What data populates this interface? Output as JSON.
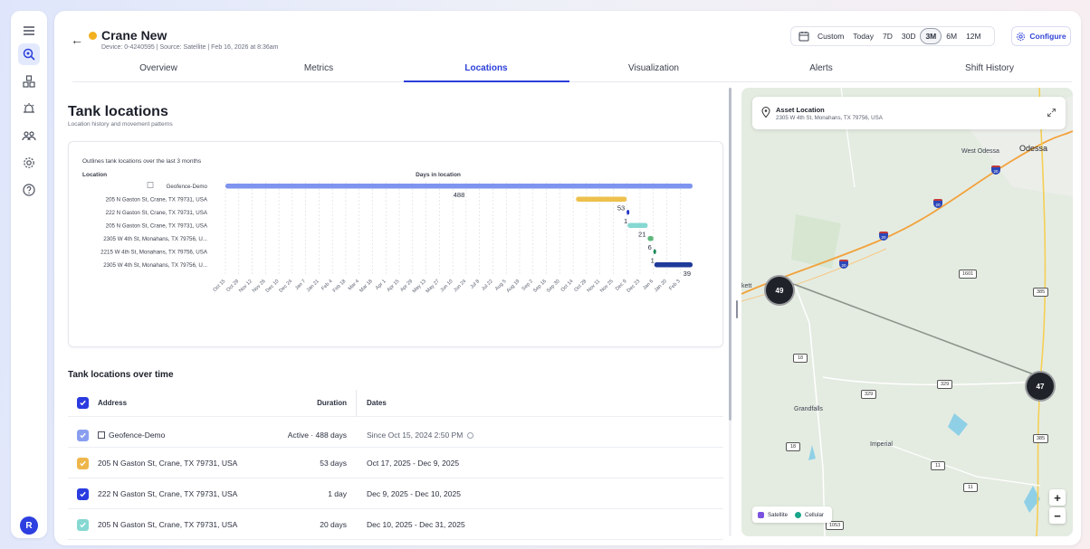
{
  "rail": {
    "items": [
      "menu-icon",
      "assets-icon",
      "sites-icon",
      "alerts-icon",
      "users-icon",
      "settings-icon",
      "help-icon"
    ],
    "avatar_initial": "R"
  },
  "asset": {
    "name": "Crane New",
    "status_color": "#f2b01e",
    "meta": "Device: 0-4240595  |  Source: Satellite  |  Feb 16, 2026 at 8:36am"
  },
  "range": {
    "custom_label": "Custom",
    "options": [
      "Today",
      "7D",
      "30D",
      "3M",
      "6M",
      "12M"
    ],
    "selected": "3M"
  },
  "configure_label": "Configure",
  "tabs": [
    "Overview",
    "Metrics",
    "Locations",
    "Visualization",
    "Alerts",
    "Shift History"
  ],
  "active_tab": "Locations",
  "section": {
    "title": "Tank locations",
    "subtitle": "Location history and movement patterns"
  },
  "chart_data": {
    "type": "gantt",
    "caption": "Outlines tank locations over the last 3 months",
    "ylabel": "Location",
    "xlabel": "Days in location",
    "x_ticks": [
      "Oct 15",
      "Oct 29",
      "Nov 12",
      "Nov 26",
      "Dec 10",
      "Dec 24",
      "Jan 7",
      "Jan 21",
      "Feb 4",
      "Feb 18",
      "Mar 4",
      "Mar 18",
      "Apr 1",
      "Apr 15",
      "Apr 29",
      "May 13",
      "May 27",
      "Jun 10",
      "Jun 24",
      "Jul 8",
      "Jul 22",
      "Aug 5",
      "Aug 19",
      "Sep 2",
      "Sep 16",
      "Sep 30",
      "Oct 14",
      "Oct 28",
      "Nov 11",
      "Nov 25",
      "Dec 9",
      "Dec 23",
      "Jan 6",
      "Jan 20",
      "Feb 3"
    ],
    "rows": [
      {
        "location": "Geofence-Demo",
        "start": "2024-10-15",
        "end": "2026-02-16",
        "days": 488,
        "color": "#7f94ee"
      },
      {
        "location": "205 N Gaston St, Crane, TX 79731, USA",
        "start": "2025-10-17",
        "end": "2025-12-09",
        "days": 53,
        "color": "#eec04c"
      },
      {
        "location": "222 N Gaston St, Crane, TX 79731, USA",
        "start": "2025-12-09",
        "end": "2025-12-10",
        "days": 1,
        "color": "#2333c8"
      },
      {
        "location": "205 N Gaston St, Crane, TX 79731, USA",
        "start": "2025-12-10",
        "end": "2025-12-31",
        "days": 21,
        "color": "#86d8d2"
      },
      {
        "location": "2305 W 4th St, Monahans, TX 79756, U...",
        "start": "2025-12-31",
        "end": "2026-01-06",
        "days": 6,
        "color": "#5fb87c"
      },
      {
        "location": "2215 W 4th St, Monahans, TX 79756, USA",
        "start": "2026-01-06",
        "end": "2026-01-07",
        "days": 1,
        "color": "#1f8a5a"
      },
      {
        "location": "2305 W 4th St, Monahans, TX 79756, U...",
        "start": "2026-01-07",
        "end": "2026-02-16",
        "days": 39,
        "color": "#1e3a9a"
      }
    ]
  },
  "table": {
    "title": "Tank locations over time",
    "headers": {
      "address": "Address",
      "duration": "Duration",
      "dates": "Dates"
    },
    "rows": [
      {
        "address": "Geofence-Demo",
        "duration": "Active · 488 days",
        "dates": "Since Oct 15, 2024 2:50 PM",
        "check_color": "#8a9ef0",
        "geofence": true
      },
      {
        "address": "205 N Gaston St, Crane, TX 79731, USA",
        "duration": "53 days",
        "dates": "Oct 17, 2025 - Dec 9, 2025",
        "check_color": "#eeb64a"
      },
      {
        "address": "222 N Gaston St, Crane, TX 79731, USA",
        "duration": "1 day",
        "dates": "Dec 9, 2025 - Dec 10, 2025",
        "check_color": "#2a3be0"
      },
      {
        "address": "205 N Gaston St, Crane, TX 79731, USA",
        "duration": "20 days",
        "dates": "Dec 10, 2025 - Dec 31, 2025",
        "check_color": "#86d8d2"
      }
    ]
  },
  "map": {
    "card_title": "Asset Location",
    "card_address": "2305 W 4th St, Monahans, TX 79756, USA",
    "clusters": [
      "49",
      "47"
    ],
    "places": [
      "West Odessa",
      "Odessa",
      "Grandfalls",
      "Imperial",
      "kett"
    ],
    "routes": [
      "1601",
      "385",
      "18",
      "329",
      "329",
      "385",
      "11",
      "11",
      "18",
      "1053"
    ],
    "interstate": "20",
    "legend": {
      "satellite": "Satellite",
      "cellular": "Cellular",
      "satellite_color": "#7a52e0",
      "cellular_color": "#1aa58a"
    }
  }
}
